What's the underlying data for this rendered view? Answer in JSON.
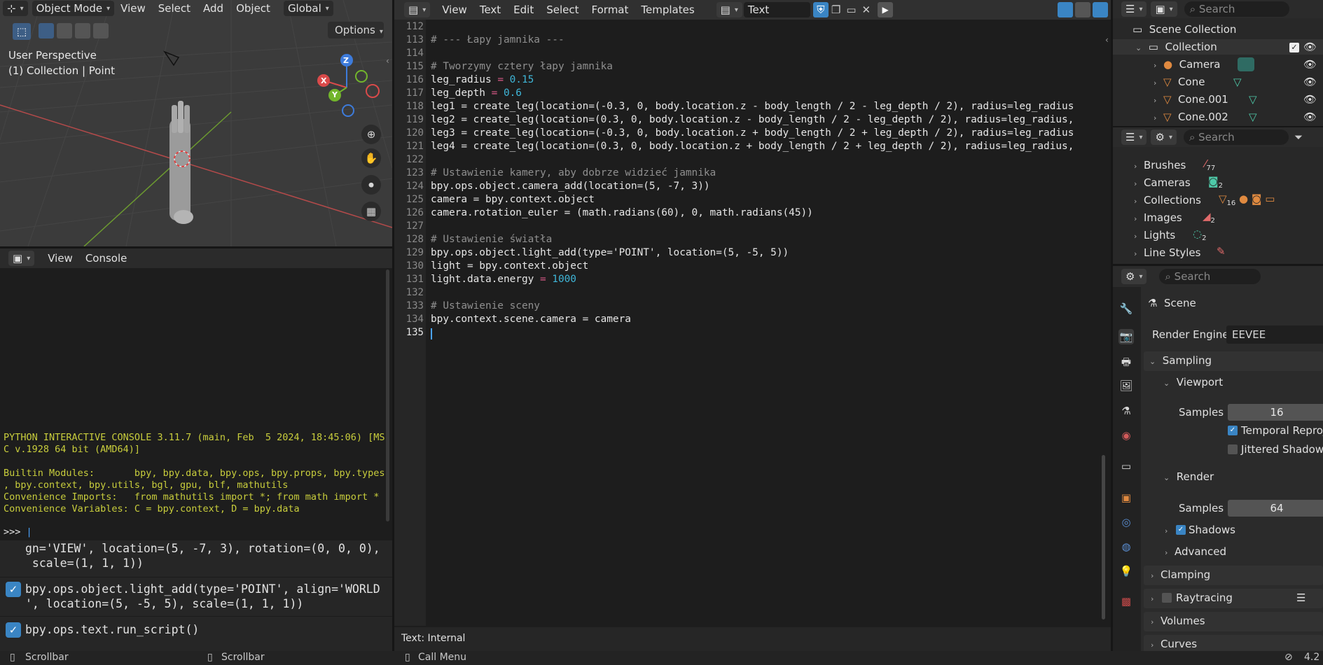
{
  "viewport": {
    "mode": "Object Mode",
    "menu": [
      "View",
      "Select",
      "Add",
      "Object"
    ],
    "transform_orientation": "Global",
    "options": "Options",
    "perspective": "User Perspective",
    "collection_info": "(1) Collection | Point",
    "axes": {
      "z": "Z",
      "x": "X",
      "y": "Y"
    }
  },
  "console": {
    "menu": [
      "View",
      "Console"
    ],
    "lines": [
      "PYTHON INTERACTIVE CONSOLE 3.11.7 (main, Feb  5 2024, 18:45:06) [MS",
      "C v.1928 64 bit (AMD64)]",
      "",
      "Builtin Modules:       bpy, bpy.data, bpy.ops, bpy.props, bpy.types",
      ", bpy.context, bpy.utils, bgl, gpu, blf, mathutils",
      "Convenience Imports:   from mathutils import *; from math import *",
      "Convenience Variables: C = bpy.context, D = bpy.data"
    ],
    "prompt": ">>> "
  },
  "info_log": {
    "line1": "gn='VIEW', location=(5, -7, 3), rotation=(0, 0, 0),",
    "line2": " scale=(1, 1, 1))",
    "line3": "bpy.ops.object.light_add(type='POINT', align='WORLD",
    "line4": "', location=(5, -5, 5), scale=(1, 1, 1))",
    "line5": "bpy.ops.text.run_script()"
  },
  "editor": {
    "menu": [
      "View",
      "Text",
      "Edit",
      "Select",
      "Format",
      "Templates"
    ],
    "text_name": "Text",
    "footer": "Text: Internal",
    "line_numbers": [
      "112",
      "113",
      "114",
      "115",
      "116",
      "117",
      "118",
      "119",
      "120",
      "121",
      "122",
      "123",
      "124",
      "125",
      "126",
      "127",
      "128",
      "129",
      "130",
      "131",
      "132",
      "133",
      "134",
      "135"
    ],
    "code": {
      "l113": "# --- Łapy jamnika ---",
      "l115": "# Tworzymy cztery łapy jamnika",
      "l116a": "leg_radius ",
      "l116b": "= ",
      "l116c": "0.15",
      "l117a": "leg_depth ",
      "l117b": "= ",
      "l117c": "0.6",
      "l118": "leg1 = create_leg(location=(-0.3, 0, body.location.z - body_length / 2 - leg_depth / 2), radius=leg_radius",
      "l119": "leg2 = create_leg(location=(0.3, 0, body.location.z - body_length / 2 - leg_depth / 2), radius=leg_radius,",
      "l120": "leg3 = create_leg(location=(-0.3, 0, body.location.z + body_length / 2 + leg_depth / 2), radius=leg_radius",
      "l121": "leg4 = create_leg(location=(0.3, 0, body.location.z + body_length / 2 + leg_depth / 2), radius=leg_radius,",
      "l123": "# Ustawienie kamery, aby dobrze widzieć jamnika",
      "l124": "bpy.ops.object.camera_add(location=(5, -7, 3))",
      "l125": "camera = bpy.context.object",
      "l126": "camera.rotation_euler = (math.radians(60), 0, math.radians(45))",
      "l128": "# Ustawienie światła",
      "l129": "bpy.ops.object.light_add(type='POINT', location=(5, -5, 5))",
      "l130": "light = bpy.context.object",
      "l131a": "light.data.energy ",
      "l131b": "= ",
      "l131c": "1000",
      "l133": "# Ustawienie sceny",
      "l134": "bpy.context.scene.camera = camera"
    }
  },
  "outliner": {
    "search_placeholder": "Search",
    "scene_collection": "Scene Collection",
    "collection": "Collection",
    "items": [
      "Camera",
      "Cone",
      "Cone.001",
      "Cone.002"
    ]
  },
  "file_browser": {
    "search_placeholder": "Search",
    "items": [
      {
        "label": "Brushes",
        "count": "77"
      },
      {
        "label": "Cameras",
        "count": "2"
      },
      {
        "label": "Collections",
        "count": "16"
      },
      {
        "label": "Images",
        "count": "2"
      },
      {
        "label": "Lights",
        "count": "2"
      },
      {
        "label": "Line Styles",
        "count": ""
      }
    ]
  },
  "properties": {
    "search_placeholder": "Search",
    "context": "Scene",
    "render_engine_label": "Render Engine",
    "render_engine": "EEVEE",
    "sampling": "Sampling",
    "viewport": "Viewport",
    "samples_label": "Samples",
    "viewport_samples": "16",
    "temporal": "Temporal Reproj...",
    "jittered": "Jittered Shadows",
    "render": "Render",
    "render_samples": "64",
    "shadows": "Shadows",
    "advanced": "Advanced",
    "clamping": "Clamping",
    "raytracing": "Raytracing",
    "volumes": "Volumes",
    "curves": "Curves"
  },
  "status": {
    "left1": "Scrollbar",
    "left2": "Scrollbar",
    "center": "Call Menu",
    "version": "4.2"
  }
}
